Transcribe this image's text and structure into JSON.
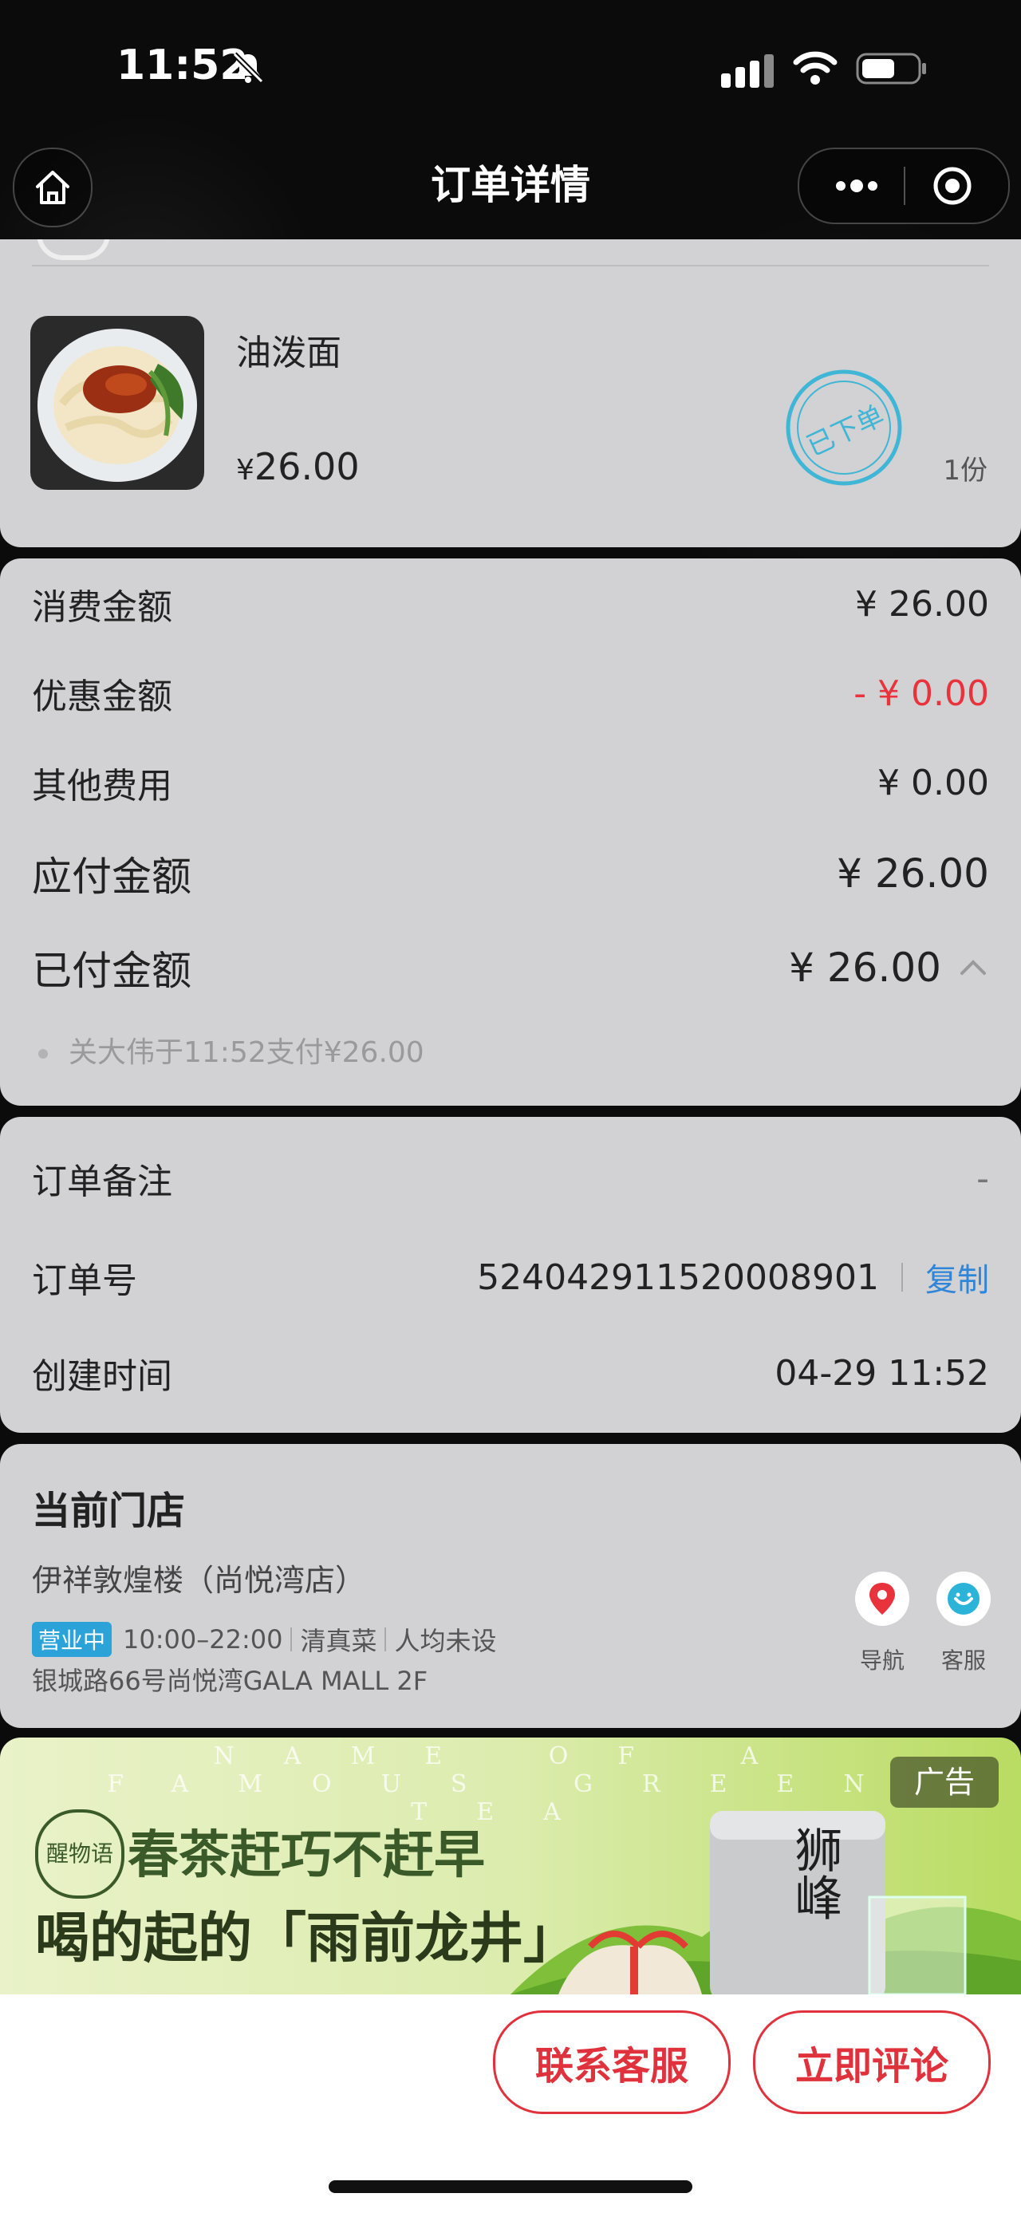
{
  "status_bar": {
    "time": "11:52"
  },
  "nav": {
    "title": "订单详情"
  },
  "item": {
    "name": "油泼面",
    "price_symbol": "¥",
    "price": "26.00",
    "stamp": "已下单",
    "qty": "1份"
  },
  "summary": {
    "rows": [
      {
        "label": "消费金额",
        "value": "¥ 26.00"
      },
      {
        "label": "优惠金额",
        "value": "- ¥ 0.00"
      },
      {
        "label": "其他费用",
        "value": "¥ 0.00"
      },
      {
        "label": "应付金额",
        "value": "¥ 26.00"
      },
      {
        "label": "已付金额",
        "value": "¥ 26.00"
      }
    ],
    "pay_detail": "关大伟于11:52支付¥26.00"
  },
  "order_info": {
    "remark_label": "订单备注",
    "remark_value": "-",
    "order_no_label": "订单号",
    "order_no": "524042911520008901",
    "copy_label": "复制",
    "created_label": "创建时间",
    "created_value": "04-29 11:52"
  },
  "store": {
    "section_title": "当前门店",
    "name": "伊祥敦煌楼（尚悦湾店）",
    "status": "营业中",
    "hours": "10:00–22:00",
    "cuisine": "清真菜",
    "avg_price": "人均未设",
    "address": "银城路66号尚悦湾GALA MALL 2F",
    "nav_label": "导航",
    "service_label": "客服"
  },
  "ad": {
    "strip_text": "NAME OF A FAMOUS GREEN TEA",
    "tag": "广告",
    "brand": "醒物语",
    "line1": "春茶赶巧不赶早",
    "line2": "喝的起的「雨前龙井」",
    "product": "狮峰"
  },
  "actions": {
    "contact": "联系客服",
    "review": "立即评论"
  },
  "colors": {
    "accent_red": "#e0323c",
    "link_blue": "#2f86d8",
    "open_badge": "#2ba3d9",
    "discount_red": "#e8323c"
  }
}
